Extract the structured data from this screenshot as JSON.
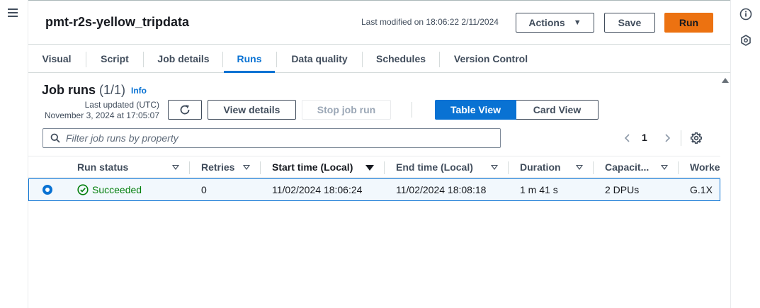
{
  "header": {
    "job_title": "pmt-r2s-yellow_tripdata",
    "last_modified": "Last modified on 18:06:22 2/11/2024",
    "actions_label": "Actions",
    "save_label": "Save",
    "run_label": "Run"
  },
  "tabs": [
    {
      "label": "Visual",
      "active": false
    },
    {
      "label": "Script",
      "active": false
    },
    {
      "label": "Job details",
      "active": false
    },
    {
      "label": "Runs",
      "active": true
    },
    {
      "label": "Data quality",
      "active": false
    },
    {
      "label": "Schedules",
      "active": false
    },
    {
      "label": "Version Control",
      "active": false
    }
  ],
  "job_runs": {
    "title": "Job runs",
    "count": "(1/1)",
    "info_label": "Info",
    "last_updated_label": "Last updated (UTC)",
    "last_updated_value": "November 3, 2024 at 17:05:07",
    "view_details_label": "View details",
    "stop_job_run_label": "Stop job run",
    "table_view_label": "Table View",
    "card_view_label": "Card View",
    "filter_placeholder": "Filter job runs by property",
    "current_page": "1"
  },
  "table": {
    "columns": [
      "Run status",
      "Retries",
      "Start time (Local)",
      "End time (Local)",
      "Duration",
      "Capacit...",
      "Worke"
    ],
    "sorted_column": "Start time (Local)",
    "rows": [
      {
        "selected": true,
        "run_status": "Succeeded",
        "retries": "0",
        "start_time": "11/02/2024 18:06:24",
        "end_time": "11/02/2024 18:08:18",
        "duration": "1 m 41 s",
        "capacity": "2 DPUs",
        "worker": "G.1X"
      }
    ]
  },
  "icons": {
    "menu": "hamburger-menu-icon",
    "info": "info-circle-icon",
    "hex": "hexagon-icon",
    "refresh": "refresh-icon",
    "search": "search-icon",
    "settings": "gear-icon",
    "status": "check-circle-icon"
  },
  "colors": {
    "accent": "#0972d3",
    "run_button": "#ec7211",
    "success": "#037f0c",
    "selected_row_bg": "#f2f8fd"
  }
}
